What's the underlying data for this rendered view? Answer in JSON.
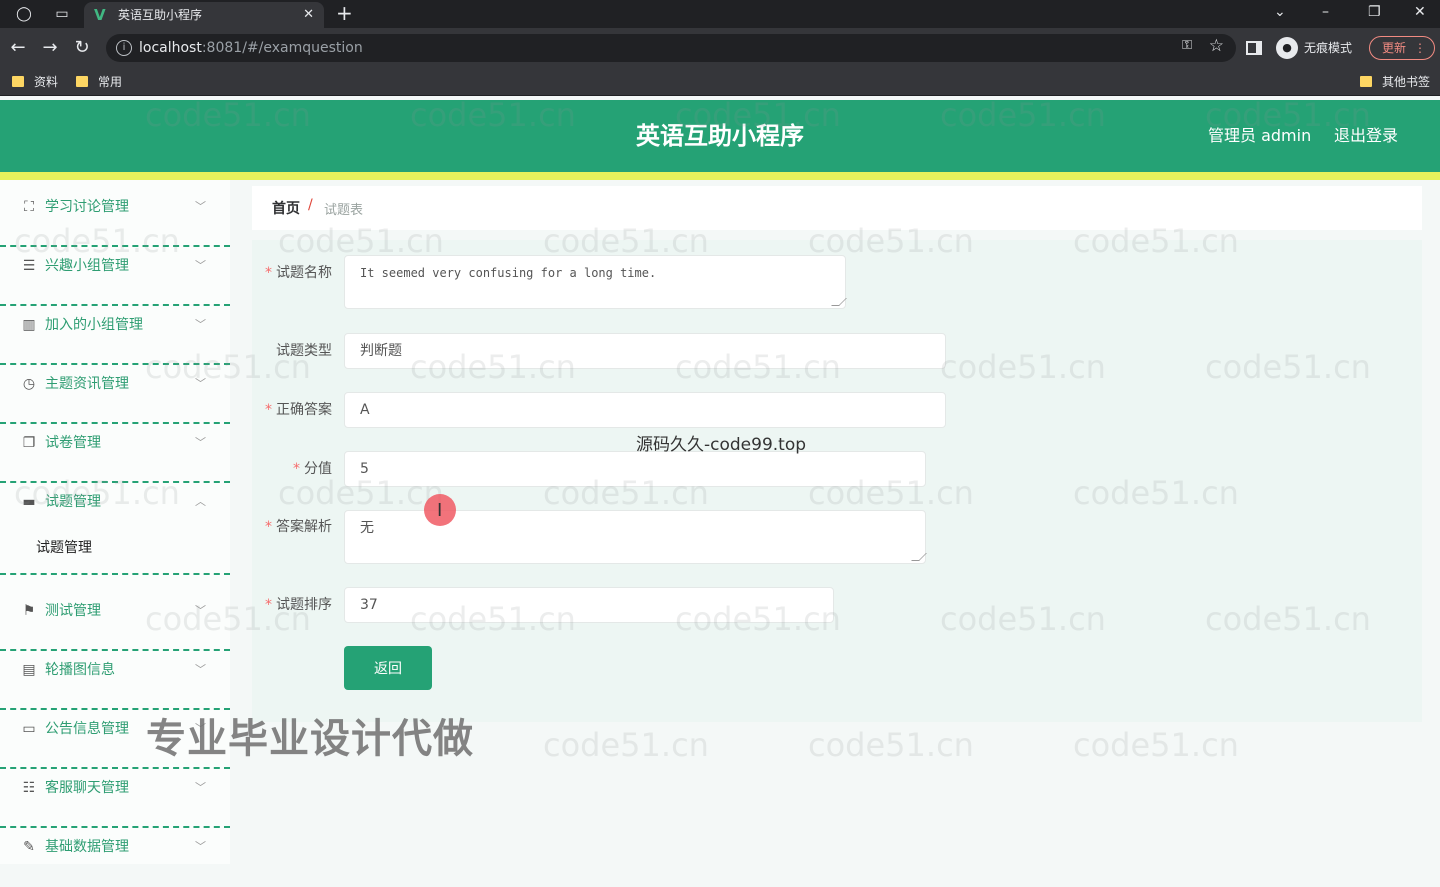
{
  "browser": {
    "tab_title": "英语互助小程序",
    "url_host": "localhost",
    "url_path": ":8081/#/examquestion",
    "incognito_label": "无痕模式",
    "update_label": "更新",
    "bookmarks": [
      "资料",
      "常用"
    ],
    "other_bookmarks": "其他书签"
  },
  "header": {
    "title": "英语互助小程序",
    "user": "管理员 admin",
    "logout": "退出登录",
    "brand_color": "#25a275",
    "accent_color": "#e7f25c"
  },
  "sidebar": {
    "items": [
      {
        "label": "学习讨论管理",
        "icon": "expand-icon"
      },
      {
        "label": "兴趣小组管理",
        "icon": "list-icon"
      },
      {
        "label": "加入的小组管理",
        "icon": "library-icon"
      },
      {
        "label": "主题资讯管理",
        "icon": "clock-icon"
      },
      {
        "label": "试卷管理",
        "icon": "copy-icon"
      },
      {
        "label": "试题管理",
        "icon": "monitor-icon",
        "expanded": true
      },
      {
        "label": "测试管理",
        "icon": "flag-icon"
      },
      {
        "label": "轮播图信息",
        "icon": "printer-icon"
      },
      {
        "label": "公告信息管理",
        "icon": "notice-icon"
      },
      {
        "label": "客服聊天管理",
        "icon": "sliders-icon"
      },
      {
        "label": "基础数据管理",
        "icon": "edit-icon"
      }
    ],
    "active_sub": "试题管理"
  },
  "breadcrumb": {
    "home": "首页",
    "separator": "/",
    "current": "试题表"
  },
  "form": {
    "name_label": "试题名称",
    "name_value": "It seemed very confusing for a long time.",
    "type_label": "试题类型",
    "type_value": "判断题",
    "answer_label": "正确答案",
    "answer_value": "A",
    "score_label": "分值",
    "score_value": "5",
    "analysis_label": "答案解析",
    "analysis_value": "无",
    "order_label": "试题排序",
    "order_value": "37",
    "back_button": "返回"
  },
  "overlays": {
    "watermark": "code51.cn",
    "center_text": "源码久久-code99.top",
    "banner_text": "专业毕业设计代做"
  }
}
